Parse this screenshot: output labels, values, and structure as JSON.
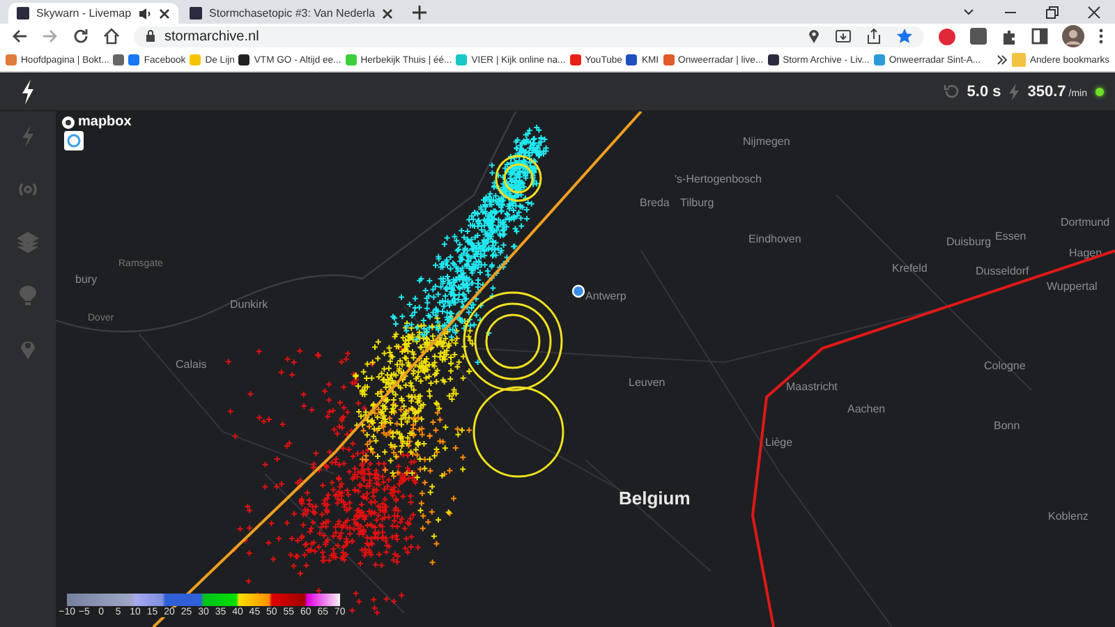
{
  "browser": {
    "tabs": [
      {
        "title": "Skywarn - Livemap",
        "selected": true,
        "audio": true
      },
      {
        "title": "Stormchasetopic #3: Van Nederla",
        "selected": false,
        "audio": false
      }
    ],
    "address": "stormarchive.nl",
    "bookmarks": [
      {
        "label": "Hoofdpagina | Bokt...",
        "color": "#e07a3a"
      },
      {
        "color": "#666666"
      },
      {
        "label": "Facebook",
        "color": "#1877f2"
      },
      {
        "label": "De Lijn",
        "color": "#f5c400"
      },
      {
        "label": "VTM GO - Altijd ee...",
        "color": "#222222"
      },
      {
        "label": "Herbekijk Thuis | éé...",
        "color": "#3ccf3c"
      },
      {
        "label": "VIER | Kijk online na...",
        "color": "#19c7c7"
      },
      {
        "label": "YouTube",
        "color": "#e62117"
      },
      {
        "label": "KMI",
        "color": "#1f4fbf"
      },
      {
        "label": "Onweerradar | live...",
        "color": "#e05a2a"
      },
      {
        "label": "Storm Archive - Liv...",
        "color": "#2a2a40"
      },
      {
        "label": "Onweerradar Sint-A...",
        "color": "#2a9ad8"
      }
    ],
    "other_bookmarks": "Andere bookmarks"
  },
  "app": {
    "interval": "5.0 s",
    "rate": "350.7",
    "rate_unit": "/min",
    "live": true
  },
  "map": {
    "attribution": "mapbox",
    "labels": [
      {
        "text": "Nijmegen",
        "kind": "city"
      },
      {
        "text": "'s-Hertogenbosch",
        "kind": "city"
      },
      {
        "text": "Breda",
        "kind": "city"
      },
      {
        "text": "Tilburg",
        "kind": "city"
      },
      {
        "text": "Eindhoven",
        "kind": "city"
      },
      {
        "text": "Essen",
        "kind": "city"
      },
      {
        "text": "Dortmund",
        "kind": "city"
      },
      {
        "text": "Duisburg",
        "kind": "city"
      },
      {
        "text": "Krefeld",
        "kind": "city"
      },
      {
        "text": "Hagen",
        "kind": "city"
      },
      {
        "text": "Dusseldorf",
        "kind": "city"
      },
      {
        "text": "Wuppertal",
        "kind": "city"
      },
      {
        "text": "Antwerp",
        "kind": "city"
      },
      {
        "text": "Dunkirk",
        "kind": "city"
      },
      {
        "text": "Calais",
        "kind": "city"
      },
      {
        "text": "Leuven",
        "kind": "city"
      },
      {
        "text": "Maastricht",
        "kind": "city"
      },
      {
        "text": "Aachen",
        "kind": "city"
      },
      {
        "text": "Cologne",
        "kind": "city"
      },
      {
        "text": "Liège",
        "kind": "city"
      },
      {
        "text": "Bonn",
        "kind": "city"
      },
      {
        "text": "Koblenz",
        "kind": "city"
      },
      {
        "text": "bury",
        "kind": "city"
      },
      {
        "text": "Ramsgate",
        "kind": "town"
      },
      {
        "text": "Dover",
        "kind": "town"
      },
      {
        "text": "Belgium",
        "kind": "country"
      }
    ],
    "legend": [
      "−10",
      "−5",
      "0",
      "5",
      "10",
      "15",
      "20",
      "25",
      "30",
      "35",
      "40",
      "45",
      "50",
      "55",
      "60",
      "65",
      "70"
    ]
  }
}
